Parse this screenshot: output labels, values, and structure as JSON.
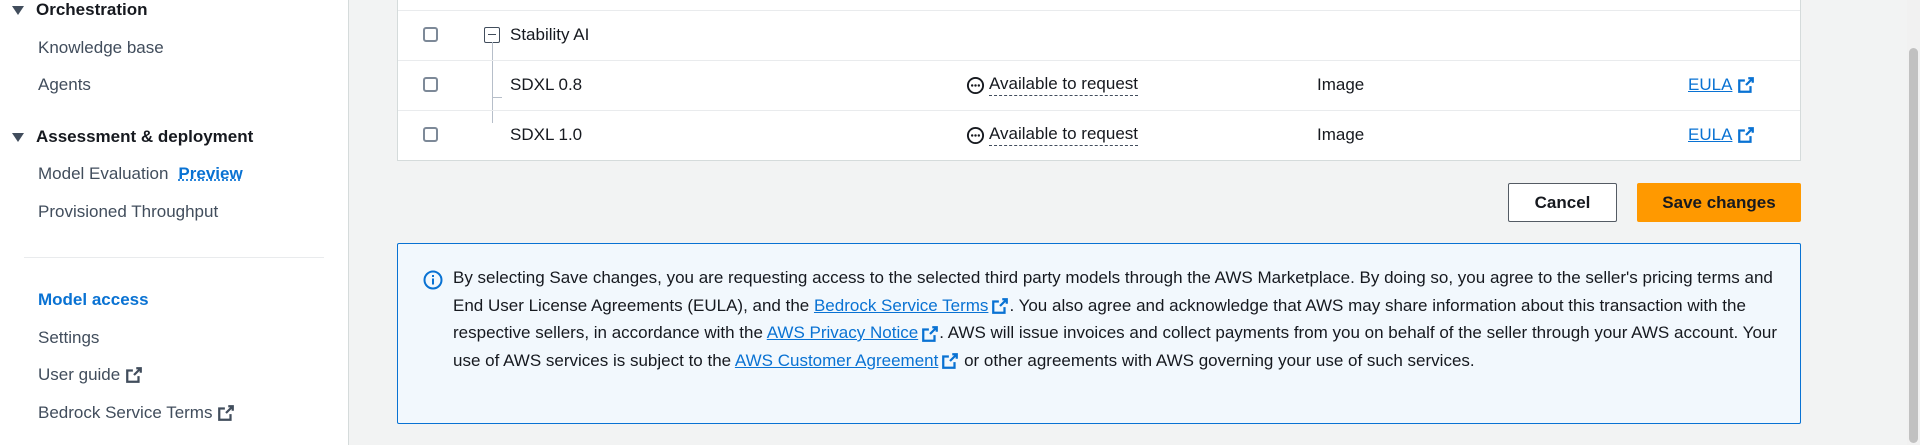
{
  "sidebar": {
    "orchestration": {
      "header": "Orchestration",
      "items": [
        "Knowledge base",
        "Agents"
      ]
    },
    "assessment": {
      "header": "Assessment & deployment",
      "model_evaluation": "Model Evaluation",
      "preview_badge": "Preview",
      "provisioned_throughput": "Provisioned Throughput"
    },
    "model_access": "Model access",
    "settings": "Settings",
    "user_guide": "User guide",
    "bedrock_service_terms": "Bedrock Service Terms"
  },
  "table": {
    "provider_group": "Stability AI",
    "rows": [
      {
        "model": "SDXL 0.8",
        "status": "Available to request",
        "modality": "Image",
        "eula": "EULA"
      },
      {
        "model": "SDXL 1.0",
        "status": "Available to request",
        "modality": "Image",
        "eula": "EULA"
      }
    ]
  },
  "buttons": {
    "cancel": "Cancel",
    "save": "Save changes"
  },
  "alert": {
    "part1": "By selecting Save changes, you are requesting access to the selected third party models through the AWS Marketplace. By doing so, you agree to the seller's pricing terms and End User License Agreements (EULA), and the ",
    "link1": "Bedrock Service Terms",
    "part2": ". You also agree and acknowledge that AWS may share information about this transaction with the respective sellers, in accordance with the ",
    "link2": "AWS Privacy Notice",
    "part3": ". AWS will issue invoices and collect payments from you on behalf of the seller through your AWS account. Your use of AWS services is subject to the ",
    "link3": "AWS Customer Agreement",
    "part4": " or other agreements with AWS governing your use of such services."
  },
  "colors": {
    "link": "#0972d3",
    "primary_button": "#ff9900",
    "alert_border": "#0972d3",
    "alert_background": "#f2f8fd"
  }
}
